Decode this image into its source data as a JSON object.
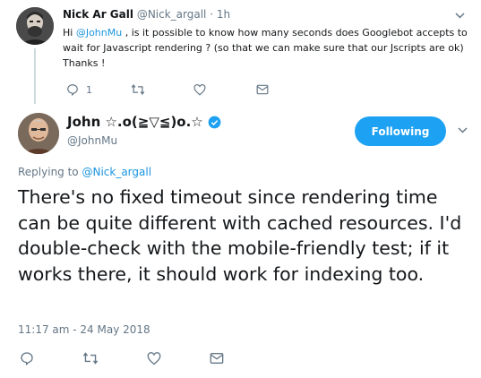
{
  "parent_tweet": {
    "name": "Nick Ar Gall",
    "handle": "@Nick_argall",
    "time": "· 1h",
    "text_prefix": "Hi ",
    "mention": "@JohnMu",
    "text_rest": " , is it possible to know how many seconds does Googlebot accepts to wait for Javascript rendering ? (so that we can make sure that our Jscripts are ok)",
    "text_line2": "Thanks !",
    "reply_count": "1",
    "icons": [
      "reply-icon",
      "retweet-icon",
      "like-icon",
      "message-icon",
      "chevron-down-icon"
    ]
  },
  "main_tweet": {
    "name": "John ☆.o(≧▽≦)o.☆",
    "handle": "@JohnMu",
    "follow_label": "Following",
    "replying_prefix": "Replying to ",
    "replying_handle": "@Nick_argall",
    "text": "There's no fixed timeout since rendering time can be quite different with cached resources. I'd double-check with the mobile-friendly test; if it works there, it should work for indexing too.",
    "timestamp": "11:17 am - 24 May 2018",
    "icons": [
      "reply-icon",
      "retweet-icon",
      "like-icon",
      "message-icon",
      "verified-badge-icon",
      "chevron-down-icon"
    ]
  },
  "colors": {
    "accent": "#1da1f2",
    "link": "#1b95e0",
    "muted": "#657786",
    "text": "#14171a"
  }
}
